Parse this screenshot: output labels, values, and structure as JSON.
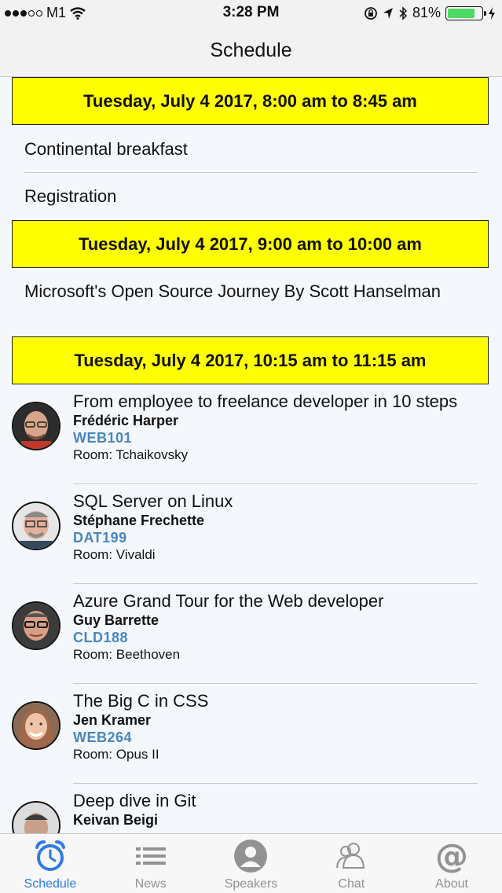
{
  "status_bar": {
    "carrier": "M1",
    "time": "3:28 PM",
    "battery": "81%",
    "battery_level": 0.81
  },
  "nav": {
    "title": "Schedule"
  },
  "schedule": {
    "blocks": [
      {
        "header": "Tuesday, July 4 2017, 8:00 am to 8:45 am"
      },
      {
        "header": "Tuesday, July 4 2017, 9:00 am to 10:00 am"
      },
      {
        "header": "Tuesday, July 4 2017, 10:15 am to 11:15 am"
      }
    ],
    "plain_items": [
      {
        "title": "Continental breakfast"
      },
      {
        "title": "Registration"
      },
      {
        "title": "Microsoft's Open Source Journey By Scott Hanselman"
      }
    ],
    "sessions": [
      {
        "title": "From employee to freelance developer in 10 steps",
        "speaker": "Frédéric Harper",
        "code": "WEB101",
        "room": "Room: Tchaikovsky"
      },
      {
        "title": "SQL Server on Linux",
        "speaker": "Stéphane Frechette",
        "code": "DAT199",
        "room": "Room: Vivaldi"
      },
      {
        "title": "Azure Grand Tour for the Web developer",
        "speaker": "Guy Barrette",
        "code": "CLD188",
        "room": "Room: Beethoven"
      },
      {
        "title": "The Big C in CSS",
        "speaker": "Jen Kramer",
        "code": "WEB264",
        "room": "Room: Opus II"
      },
      {
        "title": "Deep dive in Git",
        "speaker": "Keivan Beigi",
        "code": "",
        "room": ""
      }
    ]
  },
  "tabs": [
    {
      "label": "Schedule",
      "icon": "alarm-clock-icon",
      "active": true
    },
    {
      "label": "News",
      "icon": "list-icon",
      "active": false
    },
    {
      "label": "Speakers",
      "icon": "person-icon",
      "active": false
    },
    {
      "label": "Chat",
      "icon": "people-icon",
      "active": false
    },
    {
      "label": "About",
      "icon": "at-sign-icon",
      "active": false
    }
  ],
  "colors": {
    "header_bg": "#ffff00",
    "accent": "#2f7be3",
    "code_color": "#4a86bd",
    "battery_green": "#4cd964"
  }
}
